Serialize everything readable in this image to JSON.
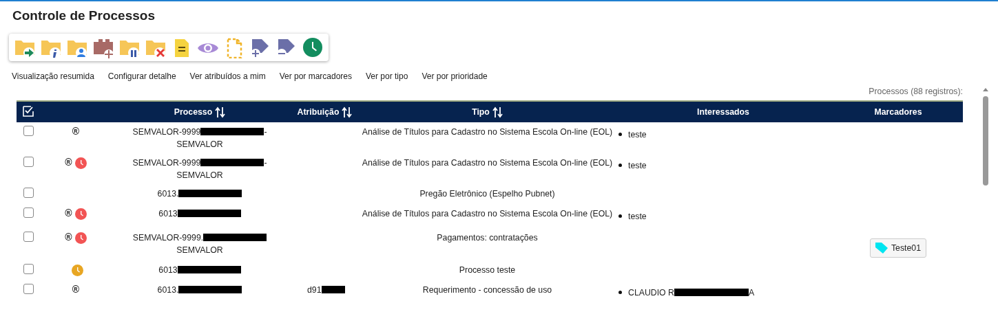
{
  "page": {
    "title": "Controle de Processos"
  },
  "toolbar": [
    {
      "kind": "folder-arrow"
    },
    {
      "kind": "folder-info"
    },
    {
      "kind": "folder-person"
    },
    {
      "kind": "block-plus"
    },
    {
      "kind": "folder-pause"
    },
    {
      "kind": "folder-x"
    },
    {
      "kind": "note"
    },
    {
      "kind": "eye"
    },
    {
      "kind": "dashed-doc"
    },
    {
      "kind": "tag-plus"
    },
    {
      "kind": "tag-minus"
    },
    {
      "kind": "clock"
    }
  ],
  "view_links": [
    "Visualização resumida",
    "Configurar detalhe",
    "Ver atribuídos a mim",
    "Ver por marcadores",
    "Ver por tipo",
    "Ver por prioridade"
  ],
  "table": {
    "caption": "Processos (88 registros):",
    "columns": [
      {
        "label": "Processo",
        "sortable": true
      },
      {
        "label": "Atribuição",
        "sortable": true
      },
      {
        "label": "Tipo",
        "sortable": true
      },
      {
        "label": "Interessados",
        "sortable": false
      },
      {
        "label": "Marcadores",
        "sortable": false
      }
    ],
    "rows": [
      {
        "checked": false,
        "flag": "®",
        "processo": {
          "before": "SEMVALOR-9999",
          "redacted": true,
          "after": "-",
          "line2": "SEMVALOR"
        },
        "tipo": "Análise de Títulos para Cadastro no Sistema Escola On-line (EOL)",
        "interessados": [
          {
            "before": "teste",
            "redacted": false
          }
        ]
      },
      {
        "checked": false,
        "flag": "®",
        "clock": {
          "color": "#f25454"
        },
        "processo": {
          "before": "SEMVALOR-9999",
          "redacted": true,
          "after": "-",
          "line2": "SEMVALOR"
        },
        "tipo": "Análise de Títulos para Cadastro no Sistema Escola On-line (EOL)",
        "interessados": [
          {
            "before": "teste",
            "redacted": false
          }
        ]
      },
      {
        "checked": false,
        "processo": {
          "before": "6013.",
          "redacted": true
        },
        "tipo": "Pregão Eletrônico (Espelho Pubnet)"
      },
      {
        "checked": false,
        "flag": "®",
        "clock": {
          "color": "#f25454"
        },
        "processo": {
          "before": "6013",
          "redacted": true
        },
        "tipo": "Análise de Títulos para Cadastro no Sistema Escola On-line (EOL)",
        "interessados": [
          {
            "before": "teste",
            "redacted": false
          }
        ]
      },
      {
        "checked": false,
        "flag": "®",
        "clock": {
          "color": "#f25454"
        },
        "processo": {
          "before": "SEMVALOR-9999.",
          "redacted": true,
          "line2": "SEMVALOR"
        },
        "tipo": "Pagamentos: contratações",
        "marcadores": [
          {
            "label": "Teste01",
            "color": "#00e5f0"
          }
        ]
      },
      {
        "checked": false,
        "clock": {
          "color": "#e8a623"
        },
        "processo": {
          "before": "6013",
          "redacted": true
        },
        "tipo": "Processo teste"
      },
      {
        "checked": false,
        "flag": "®",
        "processo": {
          "before": "6013.",
          "redacted": true
        },
        "atribuicao": {
          "before": "d91",
          "redacted": true
        },
        "tipo": "Requerimento - concessão de uso",
        "interessados": [
          {
            "before": "CLAUDIO R",
            "redacted": true,
            "after": "A"
          }
        ]
      }
    ]
  }
}
